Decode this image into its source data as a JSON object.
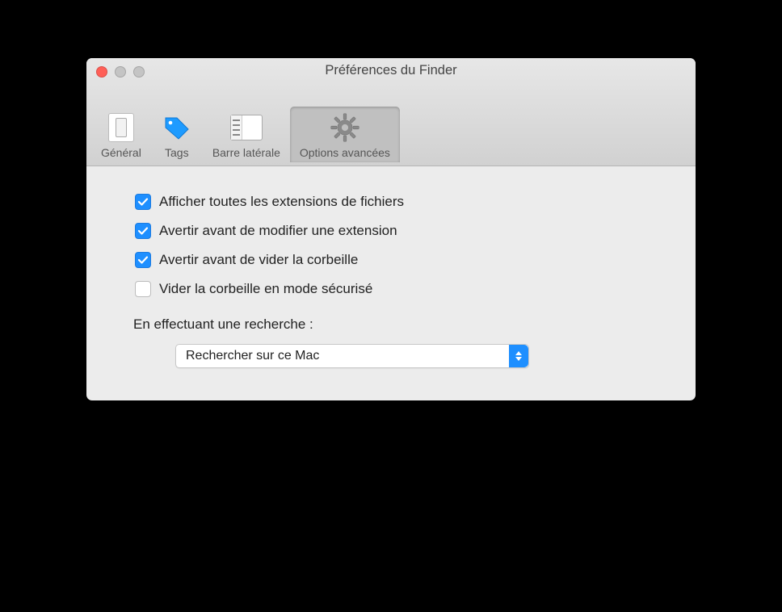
{
  "window": {
    "title": "Préférences du Finder"
  },
  "toolbar": {
    "items": [
      {
        "label": "Général"
      },
      {
        "label": "Tags"
      },
      {
        "label": "Barre latérale"
      },
      {
        "label": "Options avancées"
      }
    ],
    "selected_index": 3
  },
  "options": [
    {
      "label": "Afficher toutes les extensions de fichiers",
      "checked": true
    },
    {
      "label": "Avertir avant de modifier une extension",
      "checked": true
    },
    {
      "label": "Avertir avant de vider la corbeille",
      "checked": true
    },
    {
      "label": "Vider la corbeille en mode sécurisé",
      "checked": false
    }
  ],
  "search": {
    "label": "En effectuant une recherche :",
    "selected": "Rechercher sur ce Mac"
  },
  "colors": {
    "accent": "#1e8fff"
  }
}
